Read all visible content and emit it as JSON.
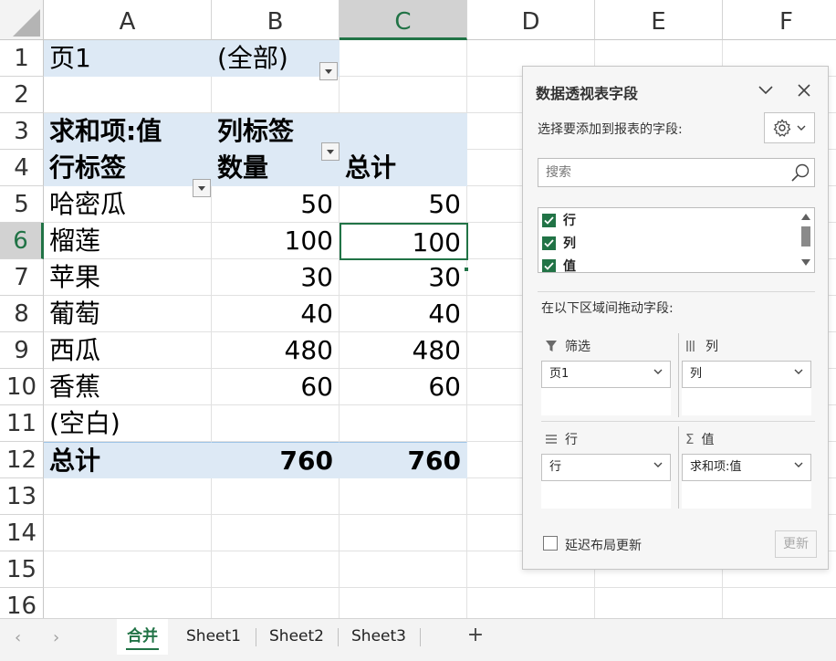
{
  "grid": {
    "columns": [
      "A",
      "B",
      "C",
      "D",
      "E",
      "F"
    ],
    "rows": [
      "1",
      "2",
      "3",
      "4",
      "5",
      "6",
      "7",
      "8",
      "9",
      "10",
      "11",
      "12",
      "13",
      "14",
      "15",
      "16"
    ],
    "selected_column": "C",
    "selected_row": "6"
  },
  "pivot_table": {
    "filter_label": "页1",
    "filter_value": "(全部)",
    "value_caption": "求和项:值",
    "column_labels_caption": "列标签",
    "row_labels_caption": "行标签",
    "quantity_header": "数量",
    "total_header": "总计",
    "rows": [
      {
        "label": "哈密瓜",
        "quantity": "50",
        "total": "50"
      },
      {
        "label": "榴莲",
        "quantity": "100",
        "total": "100"
      },
      {
        "label": "苹果",
        "quantity": "30",
        "total": "30"
      },
      {
        "label": "葡萄",
        "quantity": "40",
        "total": "40"
      },
      {
        "label": "西瓜",
        "quantity": "480",
        "total": "480"
      },
      {
        "label": "香蕉",
        "quantity": "60",
        "total": "60"
      },
      {
        "label": "(空白)",
        "quantity": "",
        "total": ""
      }
    ],
    "grand_total_label": "总计",
    "grand_total_quantity": "760",
    "grand_total_total": "760"
  },
  "field_pane": {
    "title": "数据透视表字段",
    "choose_fields_label": "选择要添加到报表的字段:",
    "search_placeholder": "搜索",
    "fields": [
      {
        "name": "行",
        "checked": true
      },
      {
        "name": "列",
        "checked": true
      },
      {
        "name": "值",
        "checked": true
      }
    ],
    "drag_areas_label": "在以下区域间拖动字段:",
    "areas": {
      "filters": {
        "title": "筛选",
        "item": "页1"
      },
      "columns": {
        "title": "列",
        "item": "列"
      },
      "rows": {
        "title": "行",
        "item": "行"
      },
      "values": {
        "title": "值",
        "item": "求和项:值"
      }
    },
    "defer_update_label": "延迟布局更新",
    "update_button": "更新"
  },
  "sheet_tabs": {
    "tabs": [
      "合并",
      "Sheet1",
      "Sheet2",
      "Sheet3"
    ],
    "active": "合并",
    "add_label": "+"
  },
  "colors": {
    "accent": "#217346",
    "pivot_fill": "#dde9f5"
  }
}
